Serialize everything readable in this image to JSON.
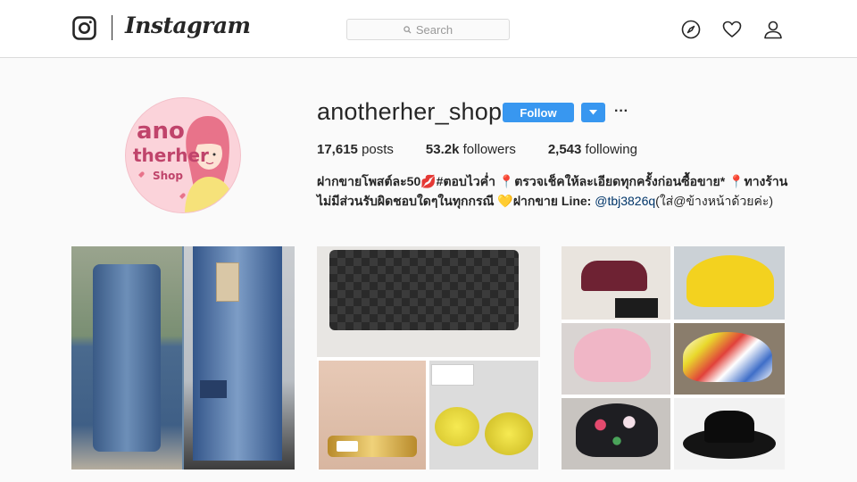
{
  "nav": {
    "brand": "Instagram",
    "search_placeholder": "Search"
  },
  "profile": {
    "username": "anotherher_shop",
    "follow_label": "Follow",
    "more_label": "···",
    "avatar_text": {
      "line1": "ano",
      "line2": "therher",
      "line3": "Shop"
    },
    "stats": {
      "posts_count": "17,615",
      "posts_label": "posts",
      "followers_count": "53.2k",
      "followers_label": "followers",
      "following_count": "2,543",
      "following_label": "following"
    },
    "bio": {
      "part1": "ฝากขายโพสต์ละ50💋#ตอบไวค่ำ 📍ตรวจเช็คให้ละเอียดทุกครั้งก่อนซื้อขาย* 📍ทางร้านไม่มีส่วนรับผิดชอบใดๆในทุกกรณี 💛ฝากขาย Line: ",
      "handle": "@tbj3826q",
      "part2": "(ใส่@ข้างหน้าด้วยค่ะ)"
    }
  },
  "colors": {
    "follow_blue": "#3897f0",
    "text": "#262626",
    "background": "#fafafa",
    "border": "#dbdbdb"
  },
  "icons": [
    "instagram-glyph-icon",
    "search-icon",
    "compass-icon",
    "heart-icon",
    "user-icon",
    "caret-down-icon"
  ]
}
